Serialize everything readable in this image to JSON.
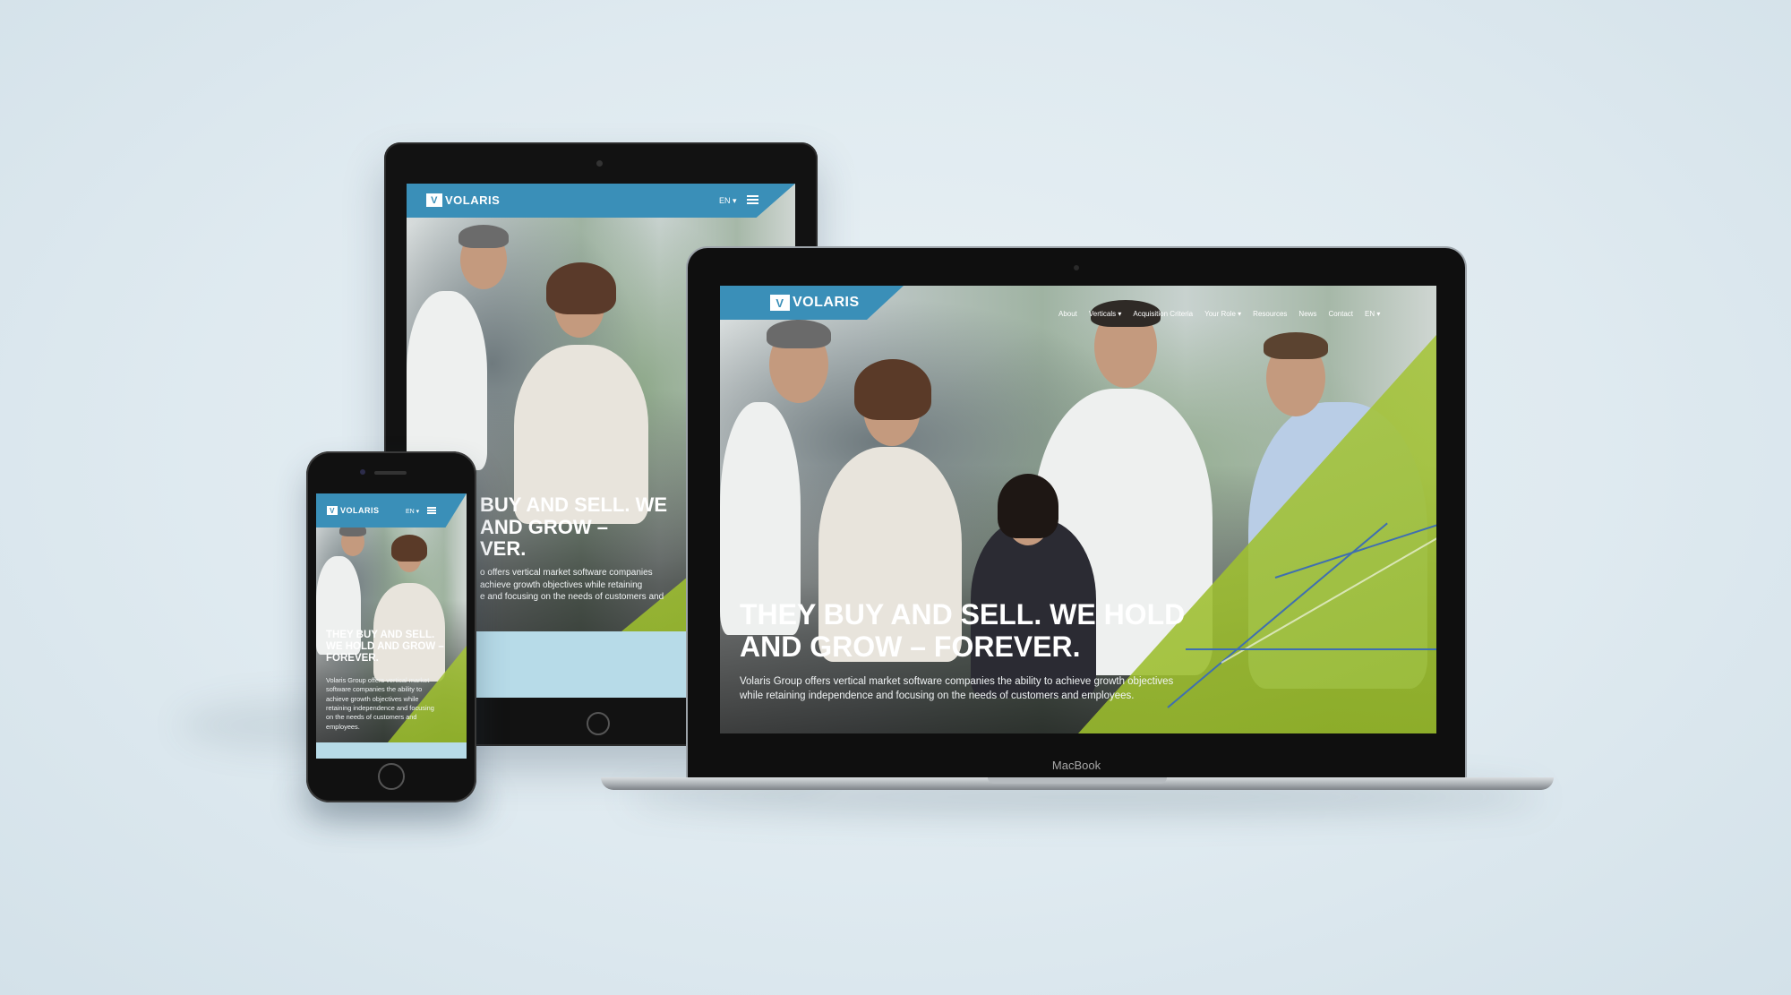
{
  "brand": {
    "logo_text": "VOLARIS",
    "accent": "#3a8fb8",
    "green": "#a8c43c"
  },
  "laptop": {
    "label": "MacBook",
    "nav": [
      {
        "label": "About"
      },
      {
        "label": "Verticals ▾"
      },
      {
        "label": "Acquisition Criteria"
      },
      {
        "label": "Your Role ▾"
      },
      {
        "label": "Resources"
      },
      {
        "label": "News"
      },
      {
        "label": "Contact"
      },
      {
        "label": "EN ▾"
      }
    ],
    "hero_title_line1": "THEY BUY AND SELL. WE HOLD",
    "hero_title_line2": "AND GROW – FOREVER.",
    "hero_desc_line1": "Volaris Group offers vertical market software companies the ability to achieve growth objectives",
    "hero_desc_line2": "while retaining independence and focusing on the needs of customers and employees."
  },
  "tablet": {
    "lang": "EN ▾",
    "hero_title_line1": "BUY AND SELL. WE",
    "hero_title_line2": "AND GROW –",
    "hero_title_line3": "VER.",
    "hero_desc_line1": "o offers vertical market software companies",
    "hero_desc_line2": "achieve growth objectives while retaining",
    "hero_desc_line3": "e and focusing on the needs of customers and"
  },
  "phone": {
    "lang": "EN ▾",
    "hero_title_line1": "THEY BUY AND SELL.",
    "hero_title_line2": "WE HOLD AND GROW –",
    "hero_title_line3": "FOREVER.",
    "hero_desc_line1": "Volaris Group offers vertical market",
    "hero_desc_line2": "software companies the ability to",
    "hero_desc_line3": "achieve growth objectives while",
    "hero_desc_line4": "retaining independence and focusing",
    "hero_desc_line5": "on the needs of customers and",
    "hero_desc_line6": "employees."
  }
}
